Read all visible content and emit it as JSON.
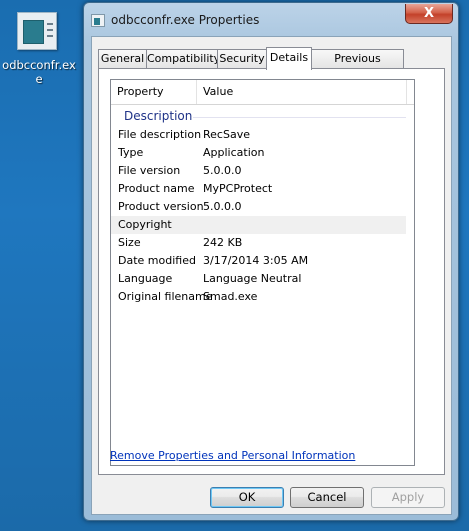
{
  "desktop": {
    "icon_label": "odbcconfr.exe"
  },
  "window": {
    "title": "odbcconfr.exe Properties",
    "close_glyph": "X"
  },
  "tabs": [
    {
      "label": "General"
    },
    {
      "label": "Compatibility"
    },
    {
      "label": "Security"
    },
    {
      "label": "Details"
    },
    {
      "label": "Previous Versions"
    }
  ],
  "active_tab": "Details",
  "details": {
    "columns": {
      "property": "Property",
      "value": "Value"
    },
    "group": "Description",
    "rows": [
      {
        "key": "File description",
        "value": "RecSave"
      },
      {
        "key": "Type",
        "value": "Application"
      },
      {
        "key": "File version",
        "value": "5.0.0.0"
      },
      {
        "key": "Product name",
        "value": "MyPCProtect"
      },
      {
        "key": "Product version",
        "value": "5.0.0.0"
      },
      {
        "key": "Copyright",
        "value": ""
      },
      {
        "key": "Size",
        "value": "242 KB"
      },
      {
        "key": "Date modified",
        "value": "3/17/2014 3:05 AM"
      },
      {
        "key": "Language",
        "value": "Language Neutral"
      },
      {
        "key": "Original filename",
        "value": "Smad.exe"
      }
    ]
  },
  "link": "Remove Properties and Personal Information",
  "buttons": {
    "ok": "OK",
    "cancel": "Cancel",
    "apply": "Apply"
  },
  "colors": {
    "desktop": "#1b6fb3",
    "link": "#0033bb",
    "group_title": "#1e3287",
    "close_button": "#c3412a"
  }
}
